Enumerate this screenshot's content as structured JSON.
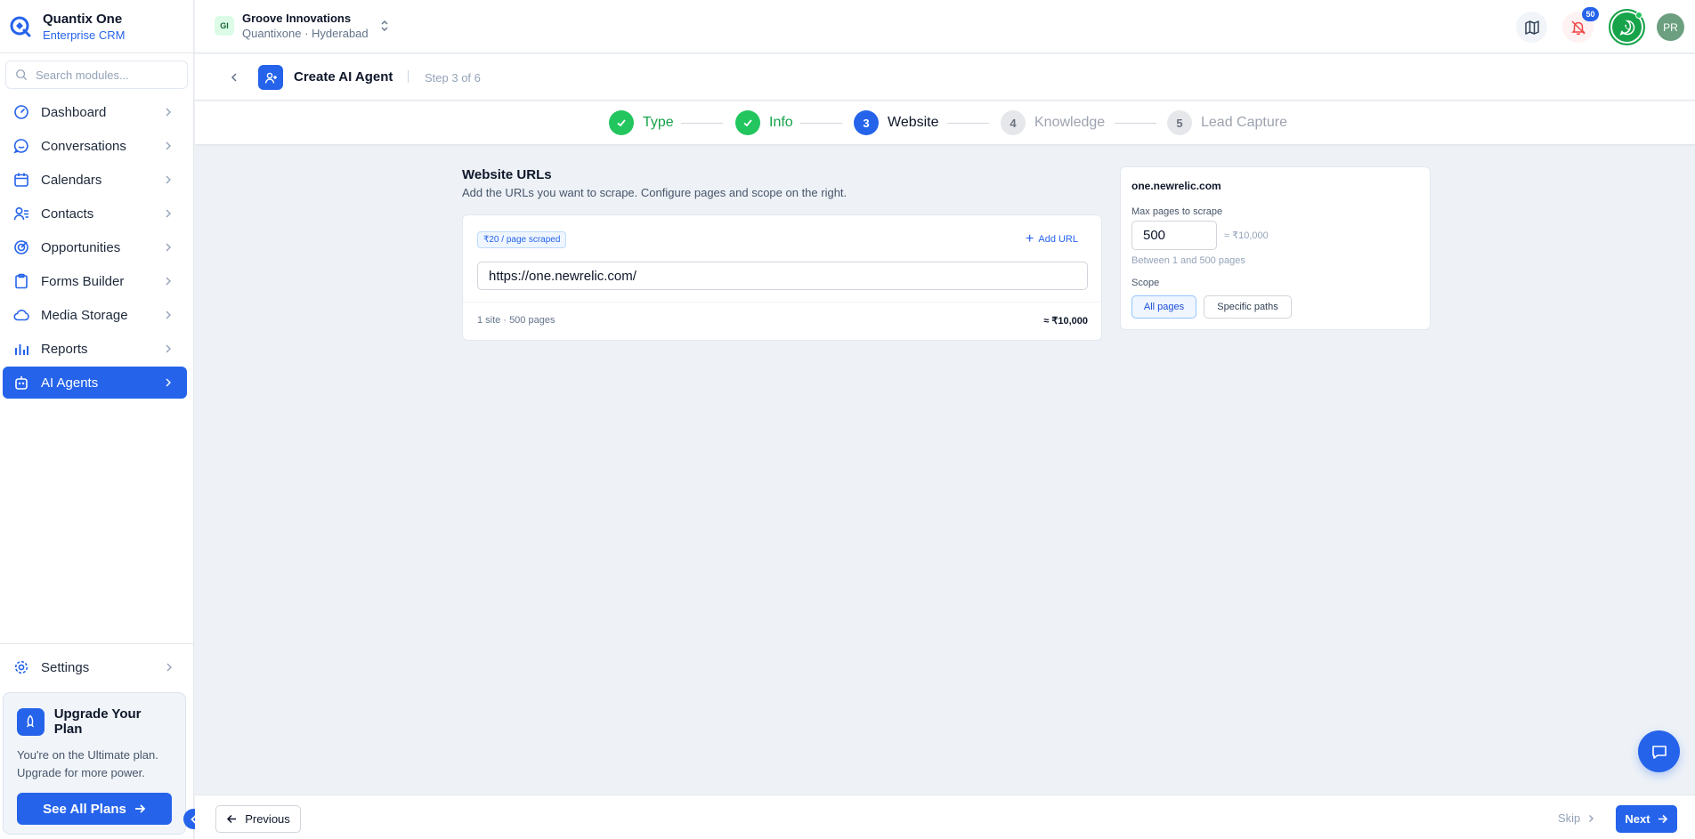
{
  "brand": {
    "name": "Quantix One",
    "subtitle": "Enterprise CRM"
  },
  "search": {
    "placeholder": "Search modules..."
  },
  "sidebar": {
    "items": [
      {
        "label": "Dashboard",
        "icon": "dashboard-icon"
      },
      {
        "label": "Conversations",
        "icon": "chat-bubble-icon"
      },
      {
        "label": "Calendars",
        "icon": "calendar-icon"
      },
      {
        "label": "Contacts",
        "icon": "contacts-icon"
      },
      {
        "label": "Opportunities",
        "icon": "target-icon"
      },
      {
        "label": "Forms Builder",
        "icon": "clipboard-icon"
      },
      {
        "label": "Media Storage",
        "icon": "cloud-icon"
      },
      {
        "label": "Reports",
        "icon": "bar-chart-icon"
      },
      {
        "label": "AI Agents",
        "icon": "robot-icon",
        "active": true
      }
    ],
    "settings_label": "Settings"
  },
  "upgrade": {
    "title": "Upgrade Your Plan",
    "text": "You're on the Ultimate plan. Upgrade for more power.",
    "button": "See All Plans"
  },
  "org": {
    "badge": "GI",
    "name": "Groove Innovations",
    "location": "Quantixone · Hyderabad"
  },
  "topbar": {
    "notification_count": "50",
    "avatar_initials": "PR"
  },
  "page": {
    "title": "Create AI Agent",
    "step_text": "Step 3 of 6"
  },
  "stepper": {
    "steps": [
      {
        "num": "1",
        "label": "Type",
        "state": "done"
      },
      {
        "num": "2",
        "label": "Info",
        "state": "done"
      },
      {
        "num": "3",
        "label": "Website",
        "state": "current"
      },
      {
        "num": "4",
        "label": "Knowledge",
        "state": "todo"
      },
      {
        "num": "5",
        "label": "Lead Capture",
        "state": "todo"
      }
    ]
  },
  "website": {
    "title": "Website URLs",
    "subtitle": "Add the URLs you want to scrape. Configure pages and scope on the right.",
    "price_tag": "₹20 / page scraped",
    "add_url_label": "Add URL",
    "url_value": "https://one.newrelic.com/",
    "summary": "1 site · 500 pages",
    "total": "≈ ₹10,000"
  },
  "config": {
    "domain": "one.newrelic.com",
    "max_pages_label": "Max pages to scrape",
    "max_pages_value": "500",
    "approx_cost": "≈ ₹10,000",
    "hint": "Between 1 and 500 pages",
    "scope_label": "Scope",
    "scope_options": [
      "All pages",
      "Specific paths"
    ],
    "scope_selected": "All pages"
  },
  "footer": {
    "previous": "Previous",
    "skip": "Skip",
    "next": "Next"
  },
  "colors": {
    "accent": "#2563eb",
    "success": "#22c55e",
    "whatsapp": "#16a34a",
    "danger": "#ef4444"
  }
}
